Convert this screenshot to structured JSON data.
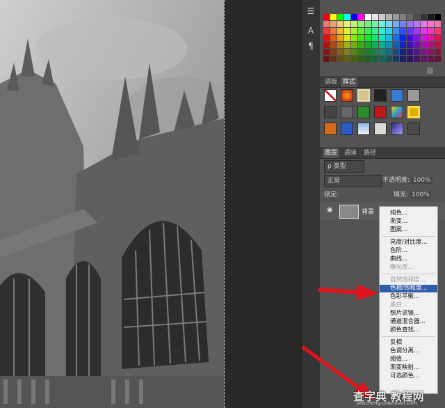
{
  "panels": {
    "styles_tabs": [
      "调板",
      "样式"
    ],
    "layers_tabs": [
      "图层",
      "通道",
      "路径"
    ],
    "filter_kind": "类型",
    "blend_mode": "正常",
    "opacity_label": "不透明度:",
    "opacity_value": "100%",
    "lock_label": "锁定:",
    "fill_label": "填充:",
    "fill_value": "100%",
    "layer_name": "背景"
  },
  "menu": {
    "items": [
      {
        "label": "纯色...",
        "enabled": true
      },
      {
        "label": "渐变...",
        "enabled": true
      },
      {
        "label": "图案...",
        "enabled": true
      },
      {
        "label": "亮度/对比度...",
        "enabled": true
      },
      {
        "label": "色阶...",
        "enabled": true
      },
      {
        "label": "曲线...",
        "enabled": true
      },
      {
        "label": "曝光度...",
        "enabled": false
      },
      {
        "label": "自然饱和度...",
        "enabled": false
      },
      {
        "label": "色相/饱和度...",
        "enabled": true,
        "highlighted": true
      },
      {
        "label": "色彩平衡...",
        "enabled": true
      },
      {
        "label": "黑白...",
        "enabled": false
      },
      {
        "label": "照片滤镜...",
        "enabled": true
      },
      {
        "label": "通道混合器...",
        "enabled": true
      },
      {
        "label": "颜色查找...",
        "enabled": true
      },
      {
        "label": "反相",
        "enabled": true
      },
      {
        "label": "色调分离...",
        "enabled": true
      },
      {
        "label": "阈值...",
        "enabled": true
      },
      {
        "label": "渐变映射...",
        "enabled": true
      },
      {
        "label": "可选颜色...",
        "enabled": true
      }
    ]
  },
  "watermark": {
    "title": "查字典 教程网",
    "url": "jiaocheng.chazidian.com"
  },
  "colors": {
    "menu_highlight": "#2f5ea8",
    "arrow": "#e0141a",
    "panel_bg": "#535353"
  }
}
